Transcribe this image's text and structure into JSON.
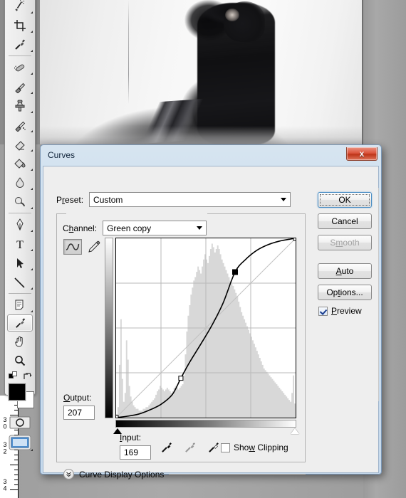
{
  "app": {
    "name": "Adobe Photoshop",
    "toolbox": {
      "tools": [
        {
          "name": "magic-wand-tool",
          "label": "Magic Wand Tool"
        },
        {
          "name": "crop-tool",
          "label": "Crop Tool"
        },
        {
          "name": "eyedropper-tool-top",
          "label": "Eyedropper Tool"
        },
        {
          "name": "healing-brush-tool",
          "label": "Spot Healing Brush Tool"
        },
        {
          "name": "brush-tool",
          "label": "Brush Tool"
        },
        {
          "name": "clone-stamp-tool",
          "label": "Clone Stamp Tool"
        },
        {
          "name": "history-brush-tool",
          "label": "History Brush Tool"
        },
        {
          "name": "eraser-tool",
          "label": "Eraser Tool"
        },
        {
          "name": "paint-bucket-tool",
          "label": "Gradient Tool"
        },
        {
          "name": "blur-tool",
          "label": "Blur Tool"
        },
        {
          "name": "dodge-tool",
          "label": "Dodge Tool"
        },
        {
          "name": "pen-tool",
          "label": "Pen Tool"
        },
        {
          "name": "type-tool",
          "label": "Horizontal Type Tool"
        },
        {
          "name": "path-selection-tool",
          "label": "Path Selection Tool"
        },
        {
          "name": "line-tool",
          "label": "Line Tool"
        },
        {
          "name": "notes-tool",
          "label": "Notes Tool"
        },
        {
          "name": "eyedropper-tool",
          "label": "Eyedropper Tool",
          "selected": true
        },
        {
          "name": "hand-tool",
          "label": "Hand Tool"
        },
        {
          "name": "zoom-tool",
          "label": "Zoom Tool"
        }
      ],
      "foreground_color": "#000000",
      "background_color": "#ffffff",
      "quick_mask_label": "Edit in Quick Mask Mode",
      "screen_mode_label": "Change Screen Mode"
    },
    "ruler": {
      "unit_marks": [
        "30",
        "32",
        "34"
      ]
    }
  },
  "dialog": {
    "title": "Curves",
    "close_label": "x",
    "preset": {
      "label": "Preset:",
      "label_prefix": "P",
      "label_underlined": "r",
      "label_suffix": "eset:",
      "value": "Custom",
      "menu_icon": "preset-options-icon"
    },
    "channel": {
      "label": "Channel:",
      "label_prefix": "C",
      "label_underlined": "h",
      "label_suffix": "annel:",
      "value": "Green copy"
    },
    "curve_tools": [
      {
        "name": "edit-points-tool",
        "label": "Edit points to modify the curve",
        "selected": true
      },
      {
        "name": "pencil-tool",
        "label": "Draw to modify the curve",
        "selected": false
      }
    ],
    "output": {
      "label": "Output:",
      "label_prefix": "",
      "label_underlined": "O",
      "label_suffix": "utput:",
      "value": "207"
    },
    "input": {
      "label": "Input:",
      "label_prefix": "",
      "label_underlined": "I",
      "label_suffix": "nput:",
      "value": "169"
    },
    "eyedroppers": [
      {
        "name": "set-black-point-dropper",
        "label": "Sample in image to set black point"
      },
      {
        "name": "set-gray-point-dropper",
        "label": "Sample in image to set gray point"
      },
      {
        "name": "set-white-point-dropper",
        "label": "Sample in image to set white point"
      }
    ],
    "show_clipping": {
      "label": "Show Clipping",
      "label_prefix": "Sho",
      "label_underlined": "w",
      "label_suffix": " Clipping",
      "checked": false
    },
    "curve_display_options": {
      "label": "Curve Display Options",
      "expanded": false
    },
    "buttons": [
      {
        "name": "ok-button",
        "label": "OK",
        "default": true,
        "enabled": true
      },
      {
        "name": "cancel-button",
        "label": "Cancel",
        "default": false,
        "enabled": true
      },
      {
        "name": "smooth-button",
        "label": "Smooth",
        "default": false,
        "enabled": false,
        "label_prefix": "S",
        "label_underlined": "m",
        "label_suffix": "ooth"
      },
      {
        "name": "auto-button",
        "label": "Auto",
        "default": false,
        "enabled": true,
        "label_prefix": "",
        "label_underlined": "A",
        "label_suffix": "uto"
      },
      {
        "name": "options-button",
        "label": "Options...",
        "default": false,
        "enabled": true,
        "label_prefix": "Op",
        "label_underlined": "t",
        "label_suffix": "ions..."
      }
    ],
    "preview": {
      "label": "Preview",
      "label_prefix": "",
      "label_underlined": "P",
      "label_suffix": "review",
      "checked": true
    },
    "accent_color": "#4b8ec4",
    "titlebar_color": "#cddff0",
    "close_button_color": "#bd3418"
  },
  "chart_data": {
    "type": "line",
    "title": "Curves tone curve",
    "xlabel": "Input",
    "ylabel": "Output",
    "xlim": [
      0,
      255
    ],
    "ylim": [
      0,
      255
    ],
    "grid": true,
    "grid_divisions": 4,
    "baseline": {
      "name": "identity-diagonal",
      "points": [
        [
          0,
          0
        ],
        [
          255,
          255
        ]
      ]
    },
    "control_points": [
      {
        "input": 0,
        "output": 0,
        "selected": false,
        "style": "hollow"
      },
      {
        "input": 92,
        "output": 56,
        "selected": false,
        "style": "hollow"
      },
      {
        "input": 169,
        "output": 207,
        "selected": true,
        "style": "filled"
      },
      {
        "input": 255,
        "output": 255,
        "selected": false,
        "style": "hollow"
      }
    ],
    "curve_points": [
      [
        0,
        0
      ],
      [
        16,
        2
      ],
      [
        32,
        5
      ],
      [
        48,
        11
      ],
      [
        64,
        19
      ],
      [
        80,
        33
      ],
      [
        92,
        56
      ],
      [
        104,
        78
      ],
      [
        120,
        104
      ],
      [
        136,
        131
      ],
      [
        152,
        163
      ],
      [
        169,
        207
      ],
      [
        184,
        225
      ],
      [
        200,
        238
      ],
      [
        216,
        246
      ],
      [
        232,
        251
      ],
      [
        248,
        254
      ],
      [
        255,
        255
      ]
    ],
    "histogram": {
      "name": "input-histogram",
      "color": "#d8d8d8",
      "bins": [
        2,
        6,
        30,
        56,
        22,
        9,
        14,
        44,
        33,
        18,
        12,
        9,
        7,
        6,
        5,
        5,
        4,
        4,
        4,
        5,
        5,
        6,
        6,
        7,
        8,
        9,
        10,
        11,
        13,
        15,
        16,
        18,
        17,
        16,
        15,
        16,
        17,
        16,
        15,
        14,
        15,
        17,
        18,
        17,
        16,
        17,
        18,
        19,
        24,
        36,
        49,
        58,
        64,
        70,
        74,
        78,
        80,
        83,
        86,
        84,
        82,
        86,
        90,
        93,
        90,
        88,
        92,
        96,
        99,
        97,
        94,
        96,
        98,
        96,
        93,
        90,
        88,
        86,
        84,
        82,
        80,
        78,
        76,
        75,
        73,
        71,
        69,
        66,
        63,
        60,
        58,
        56,
        54,
        52,
        50,
        48,
        46,
        44,
        42,
        40,
        38,
        36,
        34,
        32,
        30,
        28,
        27,
        26,
        25,
        24,
        23,
        22,
        21,
        20,
        19,
        18,
        17,
        16,
        15,
        14,
        13,
        12,
        11,
        10,
        9,
        14,
        24,
        8
      ]
    },
    "gradient_bars": {
      "vertical": {
        "name": "output-gradient-bar",
        "from": "#ffffff",
        "to": "#000000"
      },
      "horizontal": {
        "name": "input-gradient-bar",
        "from": "#000000",
        "to": "#ffffff"
      }
    },
    "sliders": [
      {
        "name": "black-point-slider",
        "position": 0,
        "style": "filled"
      },
      {
        "name": "white-point-slider",
        "position": 255,
        "style": "hollow"
      }
    ]
  }
}
